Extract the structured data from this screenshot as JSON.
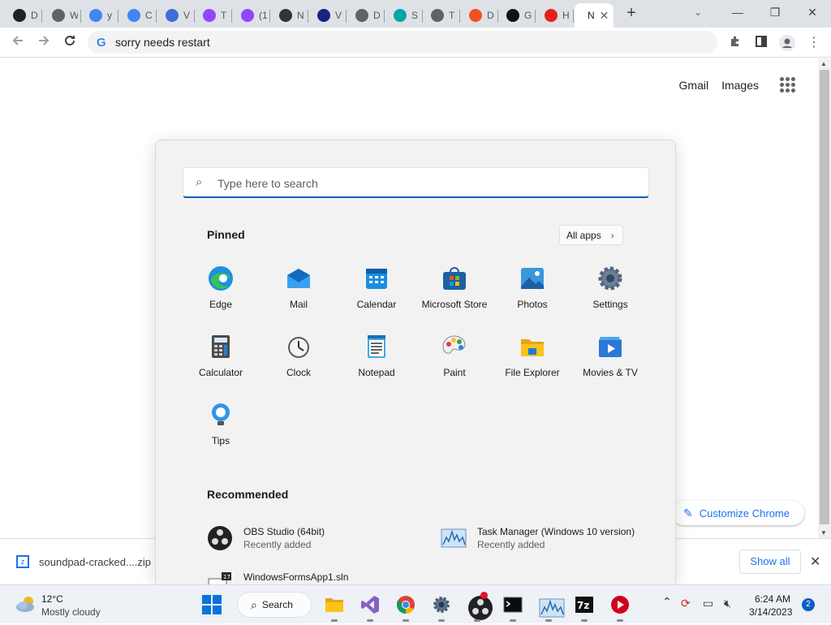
{
  "browser": {
    "tabs": [
      {
        "label": "D",
        "icon": "openai-icon",
        "color": "#202124"
      },
      {
        "label": "W",
        "icon": "chatgpt-icon",
        "color": "#5f6368"
      },
      {
        "label": "y",
        "icon": "google-icon",
        "color": "#4285f4"
      },
      {
        "label": "C",
        "icon": "google-icon",
        "color": "#4285f4"
      },
      {
        "label": "V",
        "icon": "at-sign-icon",
        "color": "#3d6fd6"
      },
      {
        "label": "T",
        "icon": "twitch-icon",
        "color": "#9146ff"
      },
      {
        "label": "(1",
        "icon": "twitch-icon",
        "color": "#9146ff"
      },
      {
        "label": "N",
        "icon": "chatgpt-icon",
        "color": "#333333"
      },
      {
        "label": "V",
        "icon": "vs-icon",
        "color": "#1a237e"
      },
      {
        "label": "D",
        "icon": "chatgpt-icon",
        "color": "#5f6368"
      },
      {
        "label": "S",
        "icon": "folder-icon",
        "color": "#00a6a6"
      },
      {
        "label": "T",
        "icon": "chatgpt-icon",
        "color": "#5f6368"
      },
      {
        "label": "D",
        "icon": "microsoft-icon",
        "color": "#f25022"
      },
      {
        "label": "G",
        "icon": "github-icon",
        "color": "#111111"
      },
      {
        "label": "H",
        "icon": "youtube-icon",
        "color": "#e62117"
      }
    ],
    "active_tab": {
      "label": "N",
      "close": "✕"
    },
    "new_tab": "+",
    "tab_search": "⌄",
    "window_controls": {
      "minimize": "—",
      "maximize": "❐",
      "close": "✕"
    },
    "omnibox_text": "sorry needs restart",
    "ntp": {
      "gmail": "Gmail",
      "images": "Images",
      "customize": "Customize Chrome"
    },
    "download": {
      "filename": "soundpad-cracked....zip",
      "show_all": "Show all"
    }
  },
  "start_menu": {
    "search_placeholder": "Type here to search",
    "pinned_title": "Pinned",
    "all_apps": "All apps",
    "pinned": [
      {
        "name": "Edge",
        "icon": "edge-icon"
      },
      {
        "name": "Mail",
        "icon": "mail-icon"
      },
      {
        "name": "Calendar",
        "icon": "calendar-icon"
      },
      {
        "name": "Microsoft Store",
        "icon": "store-icon"
      },
      {
        "name": "Photos",
        "icon": "photos-icon"
      },
      {
        "name": "Settings",
        "icon": "gear-icon"
      },
      {
        "name": "Calculator",
        "icon": "calculator-icon"
      },
      {
        "name": "Clock",
        "icon": "clock-icon"
      },
      {
        "name": "Notepad",
        "icon": "notepad-icon"
      },
      {
        "name": "Paint",
        "icon": "paint-icon"
      },
      {
        "name": "File Explorer",
        "icon": "folder-icon"
      },
      {
        "name": "Movies & TV",
        "icon": "movies-icon"
      },
      {
        "name": "Tips",
        "icon": "lightbulb-icon"
      }
    ],
    "recommended_title": "Recommended",
    "recommended": [
      {
        "name": "OBS Studio (64bit)",
        "subtitle": "Recently added",
        "icon": "obs-icon"
      },
      {
        "name": "Task Manager (Windows 10 version)",
        "subtitle": "Recently added",
        "icon": "task-manager-icon"
      },
      {
        "name": "WindowsFormsApp1.sln",
        "subtitle": "",
        "icon": "vs-solution-icon"
      }
    ]
  },
  "taskbar": {
    "weather": {
      "temp": "12°C",
      "desc": "Mostly cloudy"
    },
    "search_label": "Search",
    "apps": [
      "file-explorer-icon",
      "visual-studio-icon",
      "chrome-icon",
      "settings-icon",
      "obs-icon",
      "terminal-icon",
      "task-manager-icon",
      "7zip-icon",
      "video-player-icon"
    ],
    "clock": {
      "time": "6:24 AM",
      "date": "3/14/2023"
    },
    "notifications": "2"
  }
}
